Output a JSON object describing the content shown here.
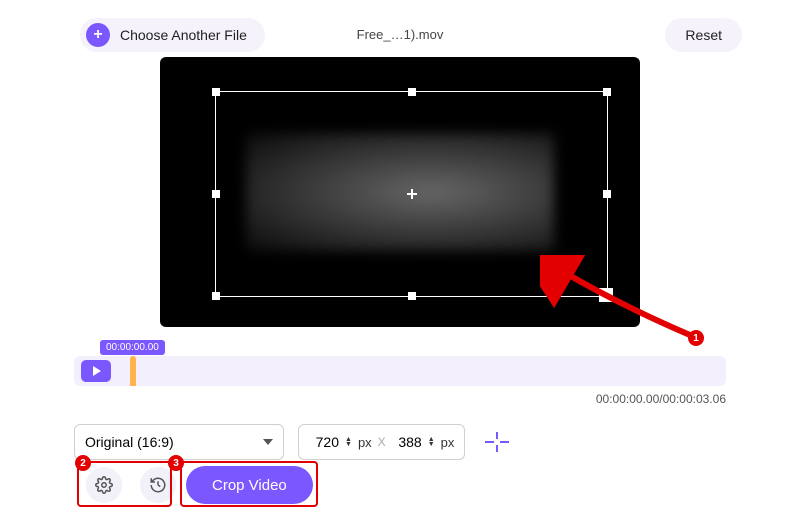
{
  "topbar": {
    "choose_label": "Choose Another File",
    "filename": "Free_…1).mov",
    "reset_label": "Reset"
  },
  "timeline": {
    "badge_time": "00:00:00.00",
    "current": "00:00:00.00",
    "duration": "00:00:03.06"
  },
  "aspect": {
    "selected": "Original (16:9)"
  },
  "dims": {
    "width": "720",
    "width_unit": "px",
    "sep": "X",
    "height": "388",
    "height_unit": "px"
  },
  "crop_button": "Crop Video",
  "annotations": {
    "a1": "1",
    "a2": "2",
    "a3": "3"
  }
}
